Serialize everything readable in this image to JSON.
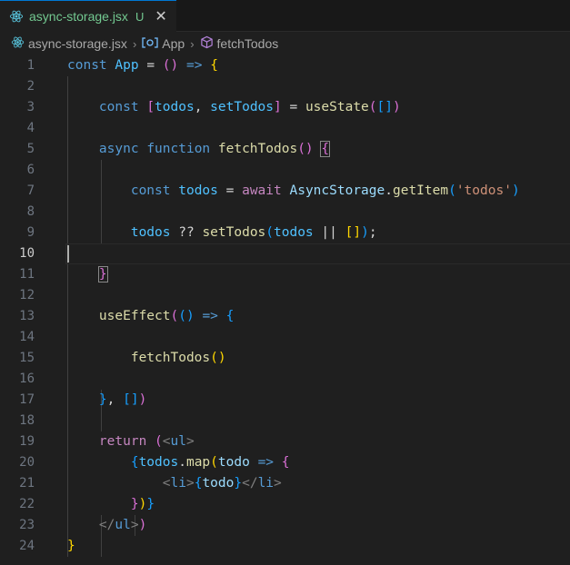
{
  "tab": {
    "filename": "async-storage.jsx",
    "status": "U"
  },
  "breadcrumb": {
    "file": "async-storage.jsx",
    "component": "App",
    "function": "fetchTodos"
  },
  "editor": {
    "line_numbers": [
      "1",
      "2",
      "3",
      "4",
      "5",
      "6",
      "7",
      "8",
      "9",
      "10",
      "11",
      "12",
      "13",
      "14",
      "15",
      "16",
      "17",
      "18",
      "19",
      "20",
      "21",
      "22",
      "23",
      "24"
    ],
    "active_line": "10"
  },
  "code": {
    "l1": {
      "kw": "const",
      "name": "App",
      "eq": "=",
      "params": "()",
      "arrow": "=>",
      "brace": "{"
    },
    "l3": {
      "kw": "const",
      "lb": "[",
      "a": "todos",
      "comma": ",",
      "b": "setTodos",
      "rb": "]",
      "eq": "=",
      "fn": "useState",
      "lp": "(",
      "arr": "[]",
      "rp": ")"
    },
    "l5": {
      "kw1": "async",
      "kw2": "function",
      "fn": "fetchTodos",
      "params": "()",
      "brace": "{"
    },
    "l7": {
      "kw": "const",
      "var": "todos",
      "eq": "=",
      "aw": "await",
      "obj": "AsyncStorage",
      "dot": ".",
      "fn": "getItem",
      "lp": "(",
      "str": "'todos'",
      "rp": ")"
    },
    "l9": {
      "a": "todos",
      "op": "??",
      "fn": "setTodos",
      "lp": "(",
      "b": "todos",
      "or": "||",
      "arr": "[]",
      "rp": ")",
      "semi": ";"
    },
    "l11": {
      "brace": "}"
    },
    "l13": {
      "fn": "useEffect",
      "lp": "(",
      "params": "()",
      "arrow": "=>",
      "brace": "{"
    },
    "l15": {
      "fn": "fetchTodos",
      "call": "()"
    },
    "l17": {
      "brace": "}",
      "comma": ",",
      "arr": "[]",
      "rp": ")"
    },
    "l19": {
      "kw": "return",
      "lp": "(",
      "open": "<",
      "tag": "ul",
      "close": ">"
    },
    "l20": {
      "lb": "{",
      "a": "todos",
      "dot": ".",
      "fn": "map",
      "lp": "(",
      "param": "todo",
      "arrow": "=>",
      "brace": "{"
    },
    "l21": {
      "o1": "<",
      "t1": "li",
      "c1": ">",
      "lb": "{",
      "v": "todo",
      "rb": "}",
      "o2": "</",
      "t2": "li",
      "c2": ">"
    },
    "l22": {
      "rb": "}",
      "rp": ")",
      "rb2": "}"
    },
    "l23": {
      "open": "</",
      "tag": "ul",
      "close": ">",
      "rp": ")"
    },
    "l24": {
      "brace": "}"
    }
  }
}
